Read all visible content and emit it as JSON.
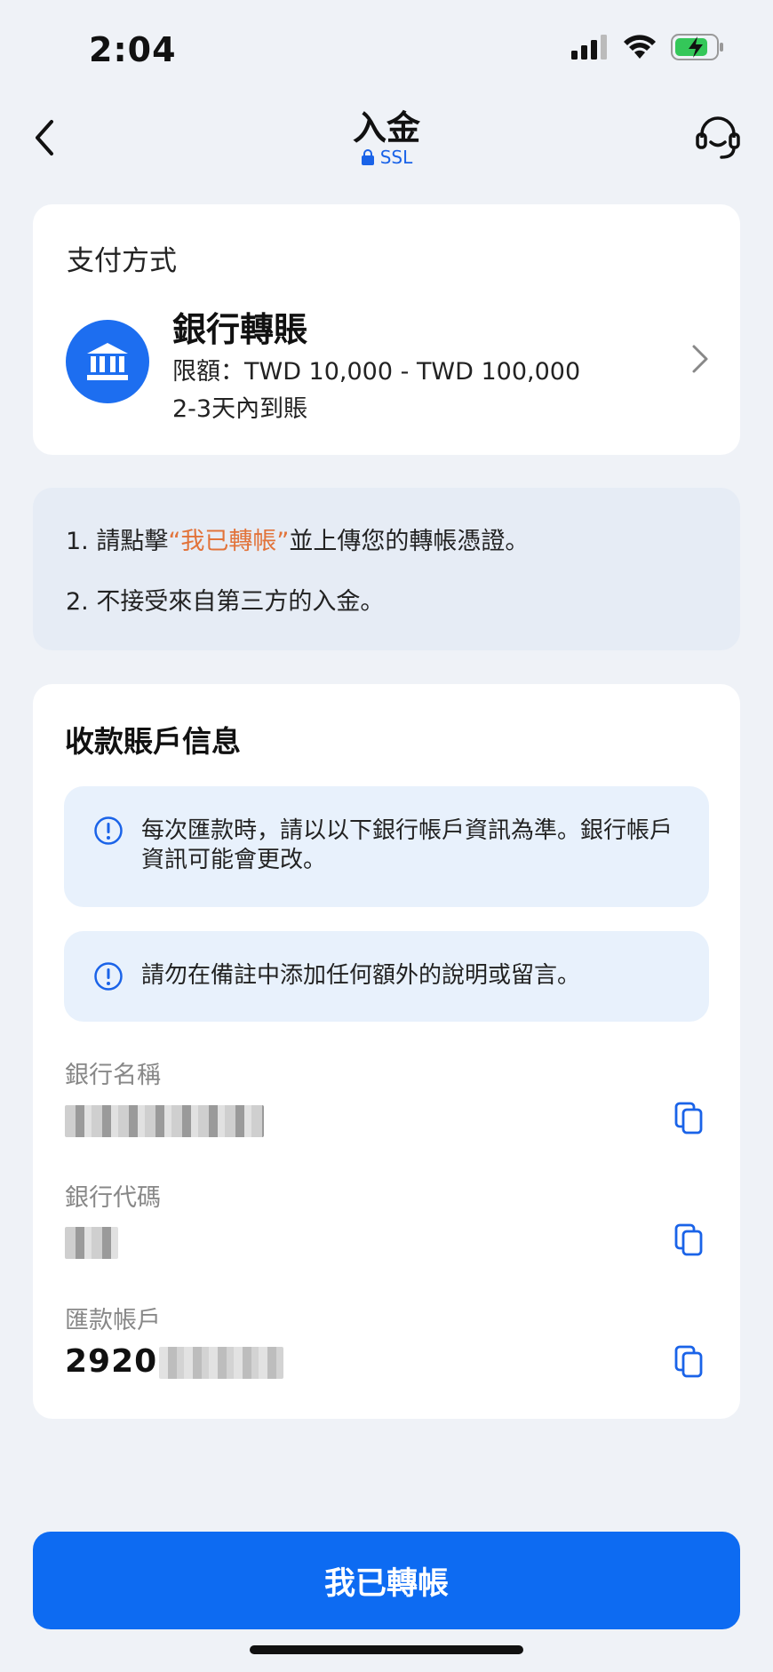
{
  "status_bar": {
    "time": "2:04"
  },
  "nav": {
    "title": "入金",
    "subtitle": "SSL"
  },
  "payment": {
    "label": "支付方式",
    "method_name": "銀行轉賬",
    "limit": "限額：TWD 10,000 - TWD 100,000",
    "arrival": "2-3天內到賬"
  },
  "notice": {
    "line1_prefix": "1. 請點擊",
    "line1_highlight": "“我已轉帳”",
    "line1_suffix": "並上傳您的轉帳憑證。",
    "line2": "2. 不接受來自第三方的入金。"
  },
  "account": {
    "title": "收款賬戶信息",
    "info1": "每次匯款時，請以以下銀行帳戶資訊為準。銀行帳戶資訊可能會更改。",
    "info2": "請勿在備註中添加任何額外的說明或留言。",
    "bank_name_label": "銀行名稱",
    "bank_code_label": "銀行代碼",
    "account_label": "匯款帳戶",
    "account_value_visible": "2920"
  },
  "cta": {
    "label": "我已轉帳"
  },
  "colors": {
    "accent": "#0d6bf2",
    "highlight": "#e2733a",
    "background": "#eff2f7"
  }
}
